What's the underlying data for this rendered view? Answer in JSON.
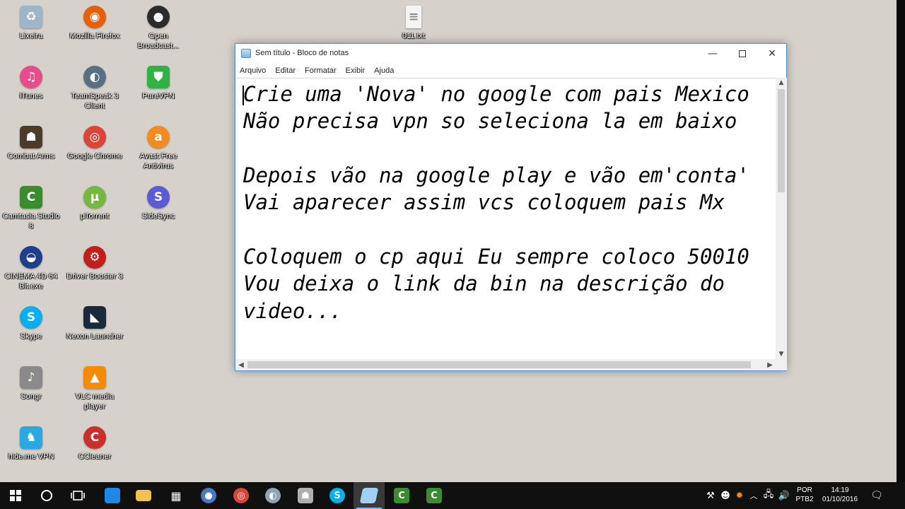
{
  "desktop": {
    "icons": [
      {
        "label": "Lixeira",
        "icon": "recycle-bin-icon",
        "color": "#9fb6c9"
      },
      {
        "label": "Mozilla Firefox",
        "icon": "firefox-icon",
        "color": "#e66000"
      },
      {
        "label": "Open Broadcast...",
        "icon": "obs-icon",
        "color": "#2b2b2b"
      },
      {
        "label": "011.txt",
        "icon": "text-file-icon",
        "color": "#f4f4f4"
      },
      {
        "label": "iTunes",
        "icon": "itunes-icon",
        "color": "#e94c8b"
      },
      {
        "label": "TeamSpeak 3 Client",
        "icon": "teamspeak-icon",
        "color": "#5a6f84"
      },
      {
        "label": "PureVPN",
        "icon": "purevpn-icon",
        "color": "#2fb344"
      },
      {
        "label": "Combat Arms",
        "icon": "combat-arms-icon",
        "color": "#4a3b2a"
      },
      {
        "label": "Google Chrome",
        "icon": "chrome-icon",
        "color": "#db4437"
      },
      {
        "label": "Avast Free Antivirus",
        "icon": "avast-icon",
        "color": "#f68a1f"
      },
      {
        "label": "Camtasia Studio 8",
        "icon": "camtasia-icon",
        "color": "#3a8d2f"
      },
      {
        "label": "µTorrent",
        "icon": "utorrent-icon",
        "color": "#76b83f"
      },
      {
        "label": "SideSync",
        "icon": "sidesync-icon",
        "color": "#5b5bd6"
      },
      {
        "label": "CINEMA 4D 64 Bit.exe",
        "icon": "cinema4d-icon",
        "color": "#1f3f8c"
      },
      {
        "label": "Driver Booster 3",
        "icon": "driver-booster-icon",
        "color": "#c0201b"
      },
      {
        "label": "Skype",
        "icon": "skype-icon",
        "color": "#00aff0"
      },
      {
        "label": "Nexon Launcher",
        "icon": "nexon-icon",
        "color": "#1b2a3a"
      },
      {
        "label": "Songr",
        "icon": "songr-icon",
        "color": "#8a8a8a"
      },
      {
        "label": "VLC media player",
        "icon": "vlc-icon",
        "color": "#f48b00"
      },
      {
        "label": "hide.me VPN",
        "icon": "hideme-icon",
        "color": "#29a9e0"
      },
      {
        "label": "CCleaner",
        "icon": "ccleaner-icon",
        "color": "#c9302c"
      }
    ]
  },
  "notepad": {
    "title": "Sem título - Bloco de notas",
    "menu": [
      "Arquivo",
      "Editar",
      "Formatar",
      "Exibir",
      "Ajuda"
    ],
    "lines": [
      "Crie uma 'Nova' no google com pais Mexico",
      "Não precisa vpn so seleciona la em baixo",
      "",
      "Depois vão na google play e vão em'conta'",
      "Vai aparecer assim vcs coloquem pais Mx",
      "",
      "Coloquem o cp aqui Eu sempre coloco 50010",
      "Vou deixa o link da bin na descrição do",
      "video..."
    ]
  },
  "taskbar": {
    "apps": [
      {
        "icon": "windows-start-icon",
        "color": "#ffffff"
      },
      {
        "icon": "cortana-search-icon",
        "color": "#ffffff"
      },
      {
        "icon": "task-view-icon",
        "color": "#ffffff"
      },
      {
        "icon": "edge-icon",
        "color": "#1e88e5"
      },
      {
        "icon": "file-explorer-icon",
        "color": "#f2c14e"
      },
      {
        "icon": "store-icon",
        "color": "#ffffff"
      },
      {
        "icon": "obs-taskbar-icon",
        "color": "#4a78c9"
      },
      {
        "icon": "chrome-taskbar-icon",
        "color": "#db4437"
      },
      {
        "icon": "teamspeak-taskbar-icon",
        "color": "#8fa3b6"
      },
      {
        "icon": "combat-arms-taskbar-icon",
        "color": "#b0b0b0"
      },
      {
        "icon": "skype-taskbar-icon",
        "color": "#00aff0"
      },
      {
        "icon": "notepad-taskbar-icon",
        "color": "#9fd0f5"
      },
      {
        "icon": "camtasia-taskbar-icon",
        "color": "#3a8d2f"
      },
      {
        "icon": "camtasia-recorder-taskbar-icon",
        "color": "#3a8d2f"
      }
    ],
    "language": "POR",
    "keyboard": "PTB2",
    "time": "14:19",
    "date": "01/10/2016"
  }
}
